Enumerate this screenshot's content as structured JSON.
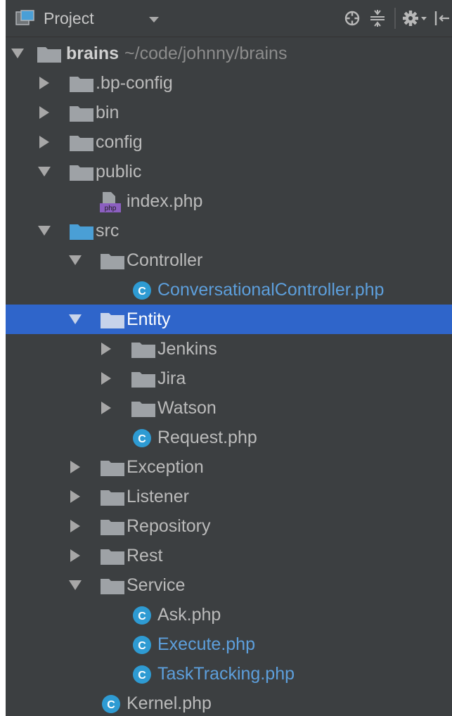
{
  "toolbar": {
    "title": "Project",
    "icons": [
      "project-view-icon",
      "dropdown-icon",
      "locate-icon",
      "collapse-all-icon",
      "settings-icon",
      "hide-icon"
    ]
  },
  "tree": {
    "root": {
      "name": "brains",
      "path": "~/code/johnny/brains"
    },
    "bp_config": ".bp-config",
    "bin": "bin",
    "config": "config",
    "public": "public",
    "index_php": "index.php",
    "src": "src",
    "controller": "Controller",
    "conversational_controller": "ConversationalController.php",
    "entity": "Entity",
    "jenkins": "Jenkins",
    "jira": "Jira",
    "watson": "Watson",
    "request_php": "Request.php",
    "exception": "Exception",
    "listener": "Listener",
    "repository": "Repository",
    "rest": "Rest",
    "service": "Service",
    "ask_php": "Ask.php",
    "execute_php": "Execute.php",
    "tasktracking_php": "TaskTracking.php",
    "kernel_php": "Kernel.php"
  },
  "colors": {
    "panel_bg": "#3c3f41",
    "selection": "#2f65ca",
    "folder": "#9ea2a6",
    "source_folder": "#4a9fd6",
    "class_badge": "#2e9bd3",
    "modified_text": "#5d9fdc",
    "php_badge": "#8c5fc0"
  }
}
